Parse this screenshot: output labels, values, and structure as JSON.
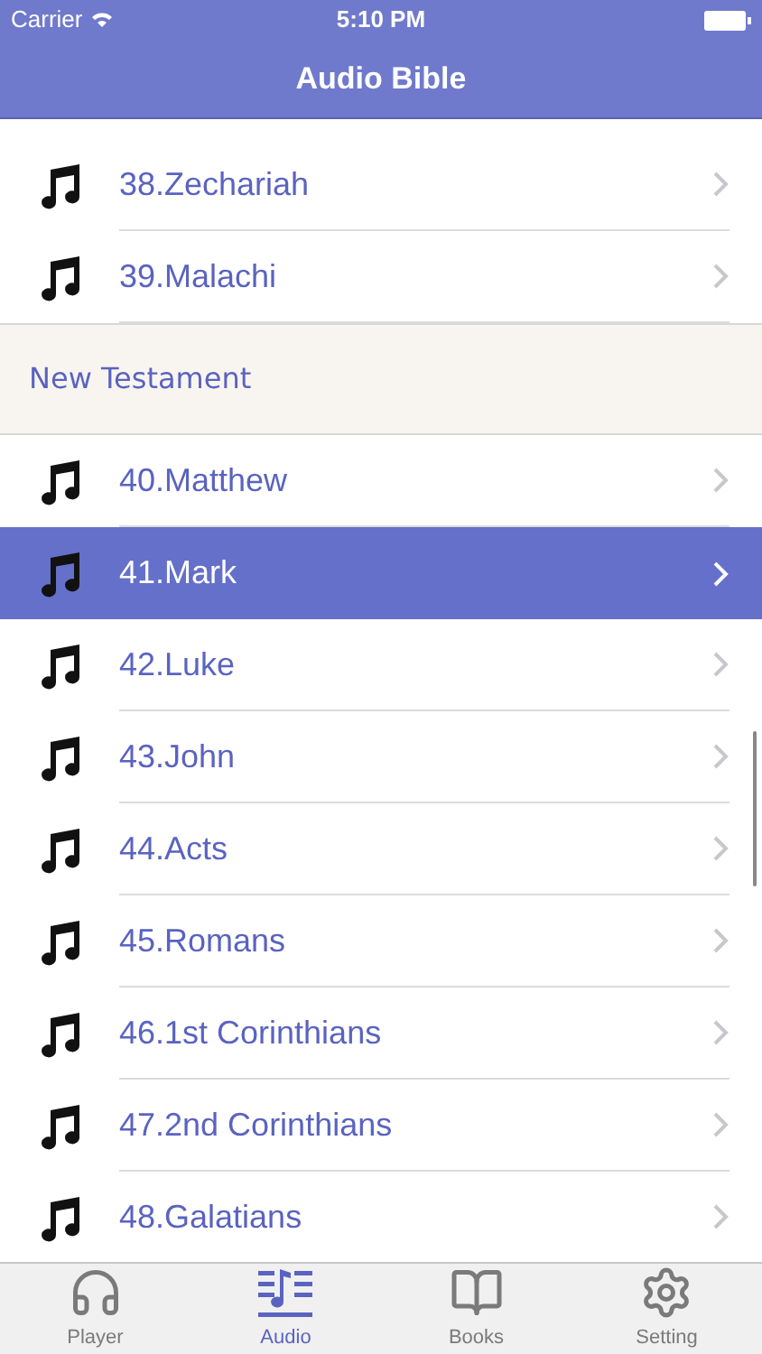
{
  "status_bar": {
    "carrier": "Carrier",
    "time": "5:10 PM"
  },
  "nav": {
    "title": "Audio Bible"
  },
  "list": [
    {
      "kind": "track",
      "label": "38.Zechariah",
      "selected": false
    },
    {
      "kind": "track",
      "label": "39.Malachi",
      "selected": false
    },
    {
      "kind": "section",
      "label": "New Testament"
    },
    {
      "kind": "track",
      "label": "40.Matthew",
      "selected": false
    },
    {
      "kind": "track",
      "label": "41.Mark",
      "selected": true
    },
    {
      "kind": "track",
      "label": "42.Luke",
      "selected": false
    },
    {
      "kind": "track",
      "label": "43.John",
      "selected": false
    },
    {
      "kind": "track",
      "label": "44.Acts",
      "selected": false
    },
    {
      "kind": "track",
      "label": "45.Romans",
      "selected": false
    },
    {
      "kind": "track",
      "label": "46.1st Corinthians",
      "selected": false
    },
    {
      "kind": "track",
      "label": "47.2nd Corinthians",
      "selected": false
    },
    {
      "kind": "track",
      "label": "48.Galatians",
      "selected": false
    }
  ],
  "tabs": [
    {
      "kind": "player",
      "label": "Player",
      "selected": false
    },
    {
      "kind": "audio",
      "label": "Audio",
      "selected": true
    },
    {
      "kind": "books",
      "label": "Books",
      "selected": false
    },
    {
      "kind": "setting",
      "label": "Setting",
      "selected": false
    }
  ]
}
